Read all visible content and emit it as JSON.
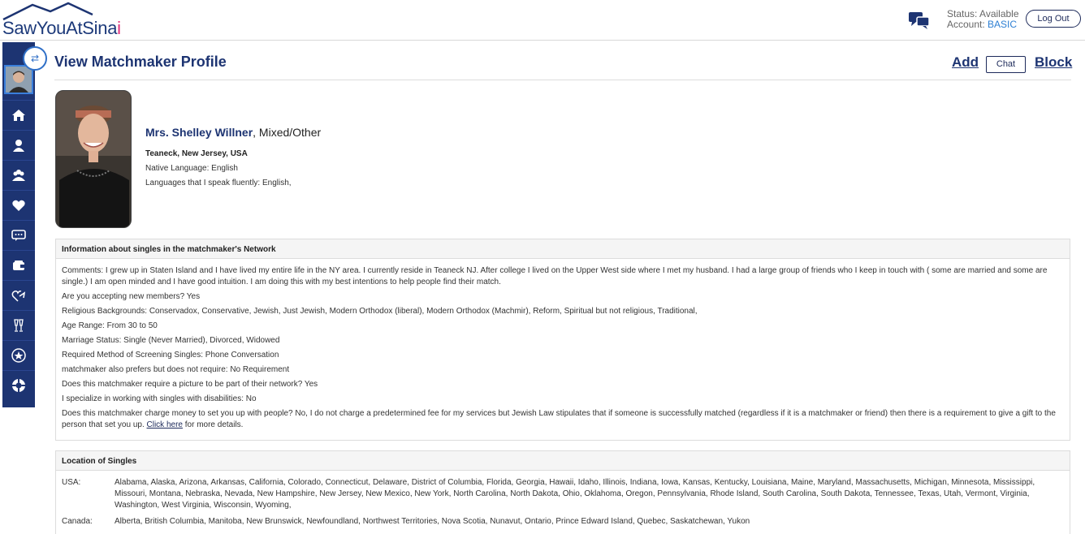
{
  "header": {
    "logo_main": "SawYouAtSina",
    "logo_accent": "i",
    "status_label": "Status: Available",
    "account_label": "Account:",
    "account_plan": "BASIC",
    "logout_label": "Log Out",
    "accent_color": "#e0307a",
    "brand_color": "#1d3472"
  },
  "sidebar": {
    "toggle_glyph": "⇄",
    "items": [
      {
        "icon": "home-icon"
      },
      {
        "icon": "user-icon"
      },
      {
        "icon": "group-icon"
      },
      {
        "icon": "heart-icon"
      },
      {
        "icon": "message-icon"
      },
      {
        "icon": "wallet-icon"
      },
      {
        "icon": "heart-share-icon"
      },
      {
        "icon": "toast-icon"
      },
      {
        "icon": "star-icon"
      },
      {
        "icon": "help-icon"
      }
    ]
  },
  "page": {
    "title": "View Matchmaker Profile",
    "add_label": "Add",
    "chat_label": "Chat",
    "block_label": "Block"
  },
  "profile": {
    "name": "Mrs. Shelley Willner",
    "name_suffix": ", Mixed/Other",
    "location": "Teaneck, New Jersey, USA",
    "native_language": "Native Language: English",
    "fluent_languages": "Languages that I speak fluently: English,"
  },
  "network_panel": {
    "heading": "Information about singles in the matchmaker's Network",
    "comments": "Comments: I grew up in Staten Island and I have lived my entire life in the NY area. I currently reside in Teaneck NJ. After college I lived on the Upper West side where I met my husband. I had a large group of friends who I keep in touch with ( some are married and some are single.) I am open minded and I have good intuition. I am doing this with my best intentions to help people find their match.",
    "accepting": "Are you accepting new members? Yes",
    "religious": "Religious Backgrounds: Conservadox, Conservative, Jewish, Just Jewish, Modern Orthodox (liberal), Modern Orthodox (Machmir), Reform, Spiritual but not religious, Traditional,",
    "age_range": "Age Range: From 30 to 50",
    "marriage_status": "Marriage Status: Single (Never Married), Divorced, Widowed",
    "screening": "Required Method of Screening Singles: Phone Conversation",
    "prefers": "matchmaker also prefers but does not require: No Requirement",
    "picture": "Does this matchmaker require a picture to be part of their network? Yes",
    "disabilities": "I specialize in working with singles with disabilities: No",
    "charge": "Does this matchmaker charge money to set you up with people? No, I do not charge a predetermined fee for my services but Jewish Law stipulates that if someone is successfully matched (regardless if it is a matchmaker or friend) then there is a requirement to give a gift to the person that set you up.",
    "click_here": "Click here",
    "more_details": " for more details."
  },
  "location_panel": {
    "heading": "Location of Singles",
    "rows": [
      {
        "label": "USA:",
        "value": "Alabama, Alaska, Arizona, Arkansas, California, Colorado, Connecticut, Delaware, District of Columbia, Florida, Georgia, Hawaii, Idaho, Illinois, Indiana, Iowa, Kansas, Kentucky, Louisiana, Maine, Maryland, Massachusetts, Michigan, Minnesota, Mississippi, Missouri, Montana, Nebraska, Nevada, New Hampshire, New Jersey, New Mexico, New York, North Carolina, North Dakota, Ohio, Oklahoma, Oregon, Pennsylvania, Rhode Island, South Carolina, South Dakota, Tennessee, Texas, Utah, Vermont, Virginia, Washington, West Virginia, Wisconsin, Wyoming,"
      },
      {
        "label": "Canada:",
        "value": "Alberta, British Columbia, Manitoba, New Brunswick, Newfoundland, Northwest Territories, Nova Scotia, Nunavut, Ontario, Prince Edward Island, Quebec, Saskatchewan, Yukon"
      }
    ]
  }
}
